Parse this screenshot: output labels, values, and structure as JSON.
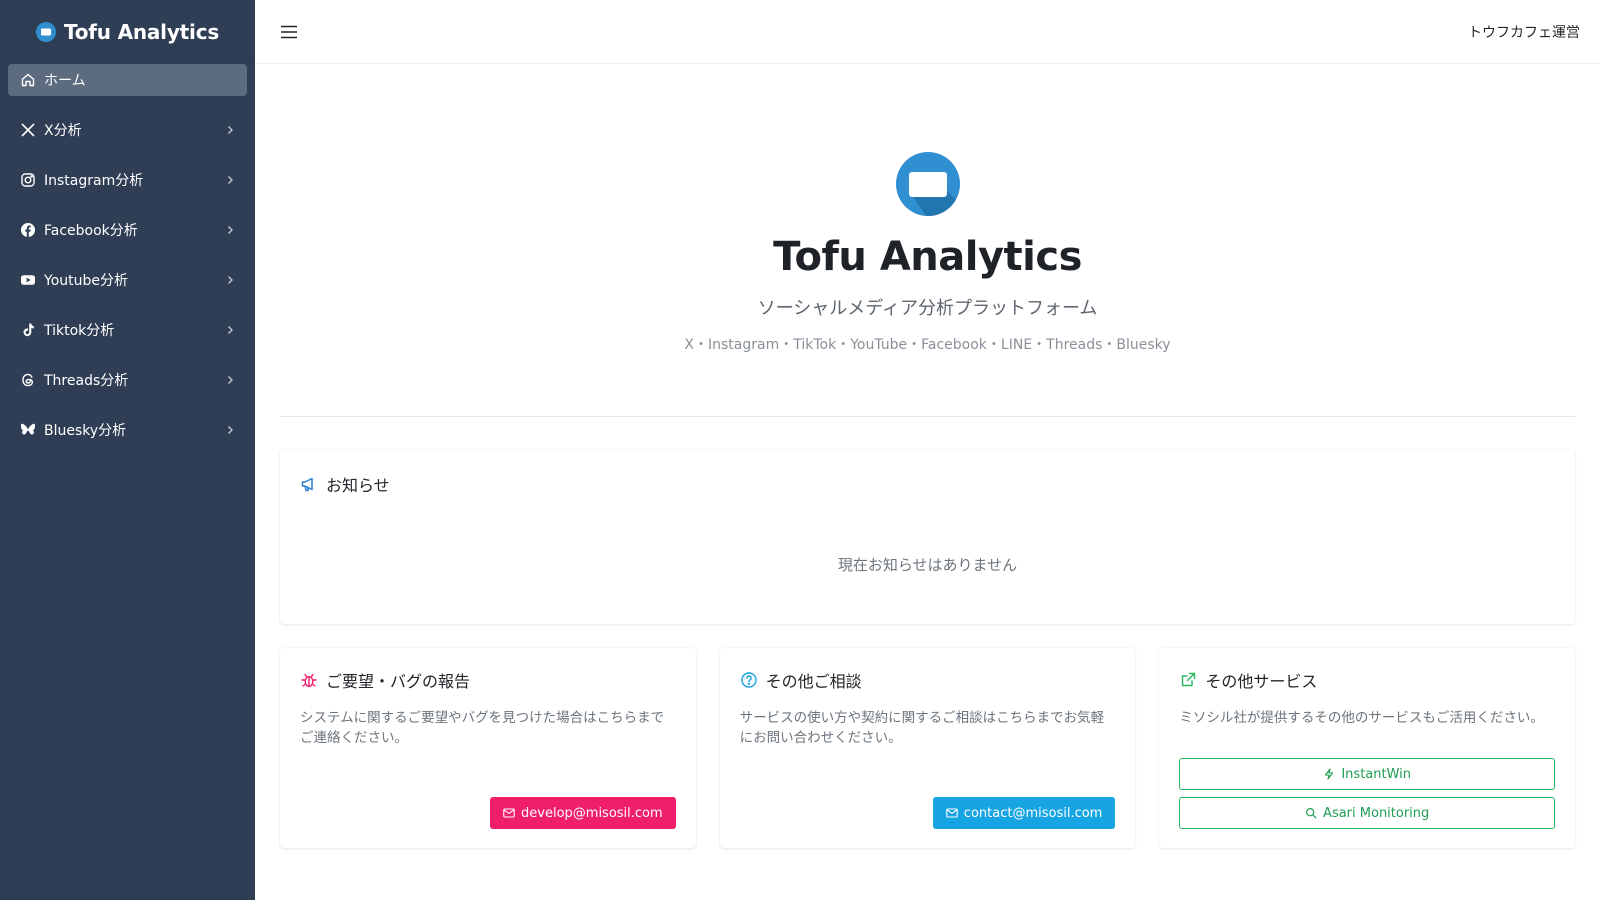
{
  "brand": {
    "name": "Tofu Analytics"
  },
  "sidebar": {
    "items": [
      {
        "label": "ホーム",
        "icon": "home-icon"
      },
      {
        "label": "X分析",
        "icon": "x-icon"
      },
      {
        "label": "Instagram分析",
        "icon": "instagram-icon"
      },
      {
        "label": "Facebook分析",
        "icon": "facebook-icon"
      },
      {
        "label": "Youtube分析",
        "icon": "youtube-icon"
      },
      {
        "label": "Tiktok分析",
        "icon": "tiktok-icon"
      },
      {
        "label": "Threads分析",
        "icon": "threads-icon"
      },
      {
        "label": "Bluesky分析",
        "icon": "bluesky-icon"
      }
    ]
  },
  "topbar": {
    "org_name": "トウフカフェ運営"
  },
  "hero": {
    "title": "Tofu Analytics",
    "subtitle": "ソーシャルメディア分析プラットフォーム",
    "platforms": "X・Instagram・TikTok・YouTube・Facebook・LINE・Threads・Bluesky"
  },
  "notice": {
    "title": "お知らせ",
    "empty": "現在お知らせはありません"
  },
  "cards": {
    "bug": {
      "title": "ご要望・バグの報告",
      "desc": "システムに関するご要望やバグを見つけた場合はこちらまでご連絡ください。",
      "button": "develop@misosil.com"
    },
    "consult": {
      "title": "その他ご相談",
      "desc": "サービスの使い方や契約に関するご相談はこちらまでお気軽にお問い合わせください。",
      "button": "contact@misosil.com"
    },
    "services": {
      "title": "その他サービス",
      "desc": "ミソシル社が提供するその他のサービスもご活用ください。",
      "buttons": [
        "InstantWin",
        "Asari Monitoring"
      ]
    }
  },
  "colors": {
    "sidebar_bg": "#2f3e54",
    "active_item": "#5d6b7f",
    "brand_blue": "#2f8fd0",
    "pink": "#ef1f6c",
    "cyan": "#17a4e2",
    "green": "#28b65e"
  }
}
